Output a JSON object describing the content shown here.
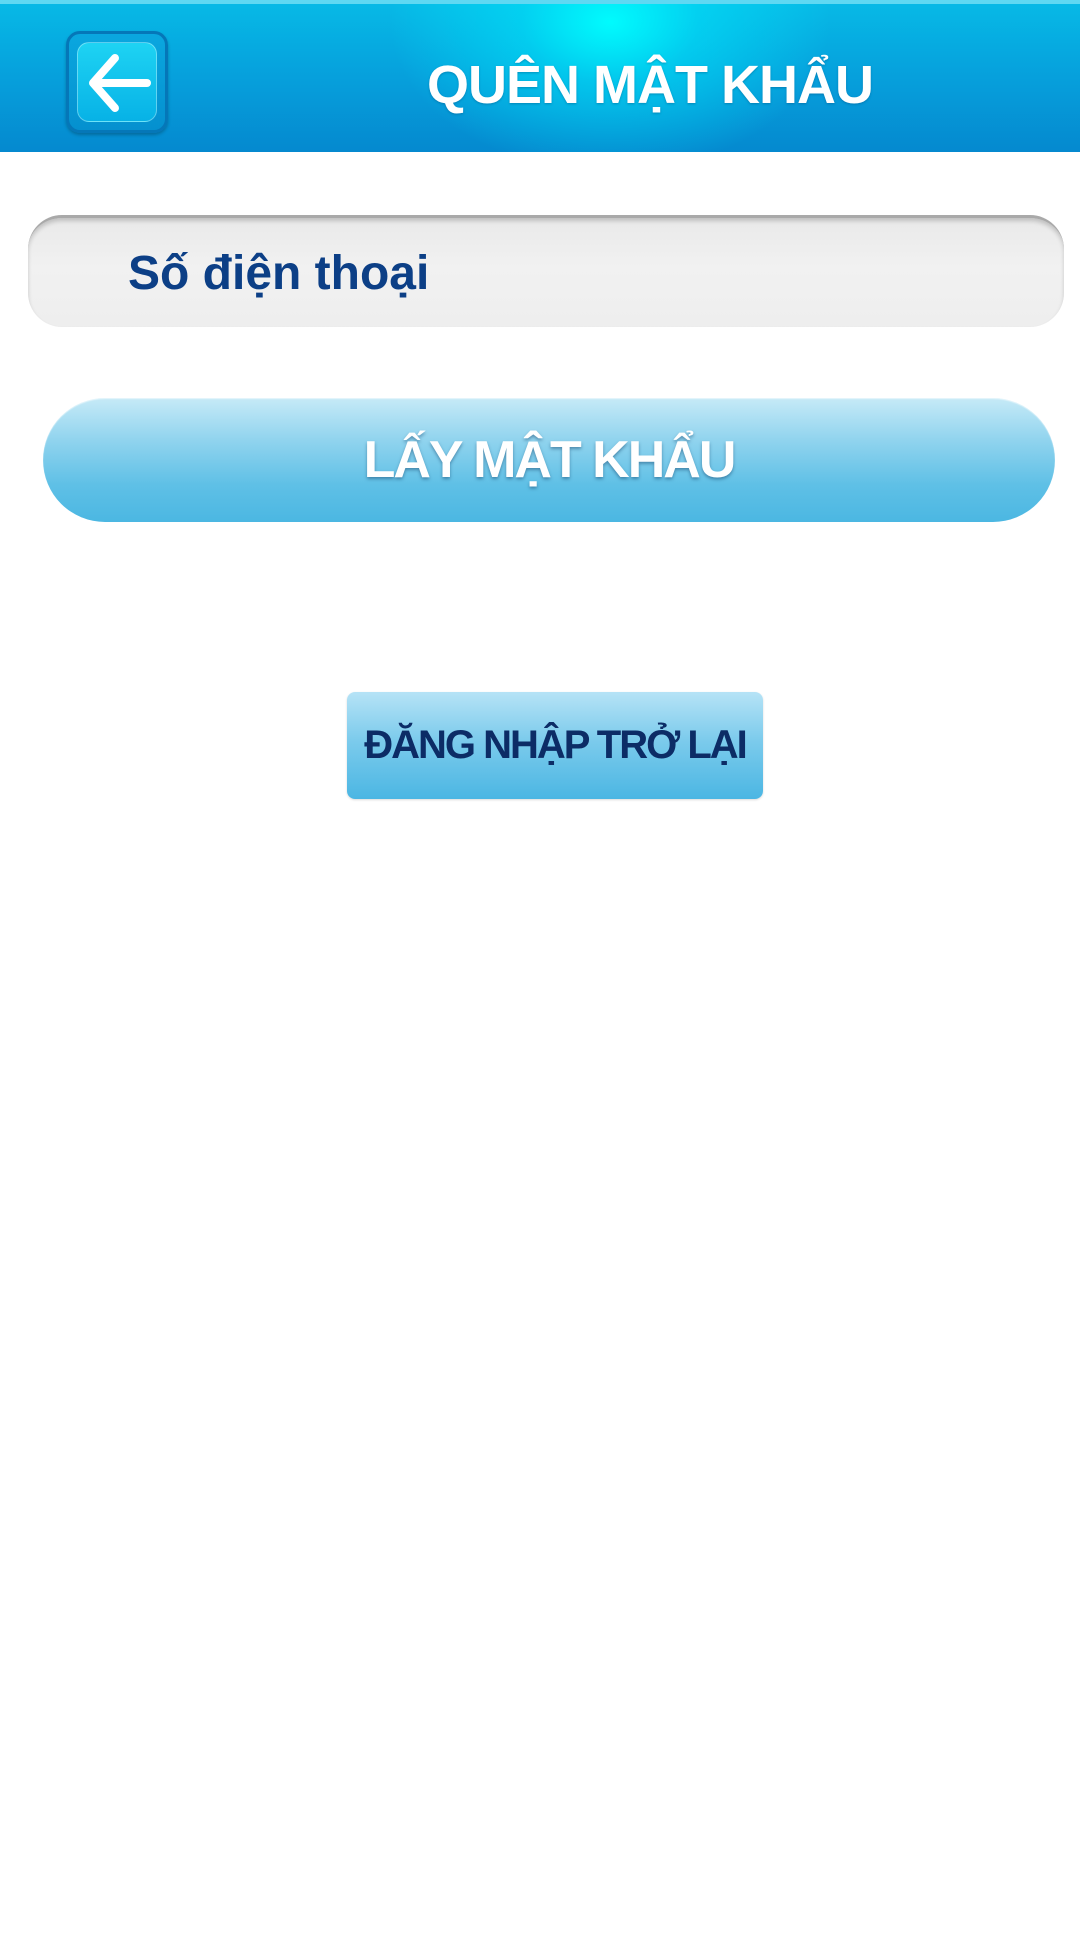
{
  "header": {
    "title": "QUÊN MẬT KHẨU",
    "back_icon": "arrow-left-icon"
  },
  "form": {
    "phone_placeholder": "Số điện thoại",
    "phone_value": "",
    "get_password_label": "LẤY MẬT KHẨU"
  },
  "footer": {
    "back_to_login_label": "ĐĂNG NHẬP TRỞ LẠI"
  },
  "colors": {
    "header_blue": "#06a2dd",
    "header_glow": "#00ffff",
    "button_blue": "#5fc0e6",
    "text_dark_blue": "#0c3f86",
    "field_gray": "#eeeeee"
  }
}
